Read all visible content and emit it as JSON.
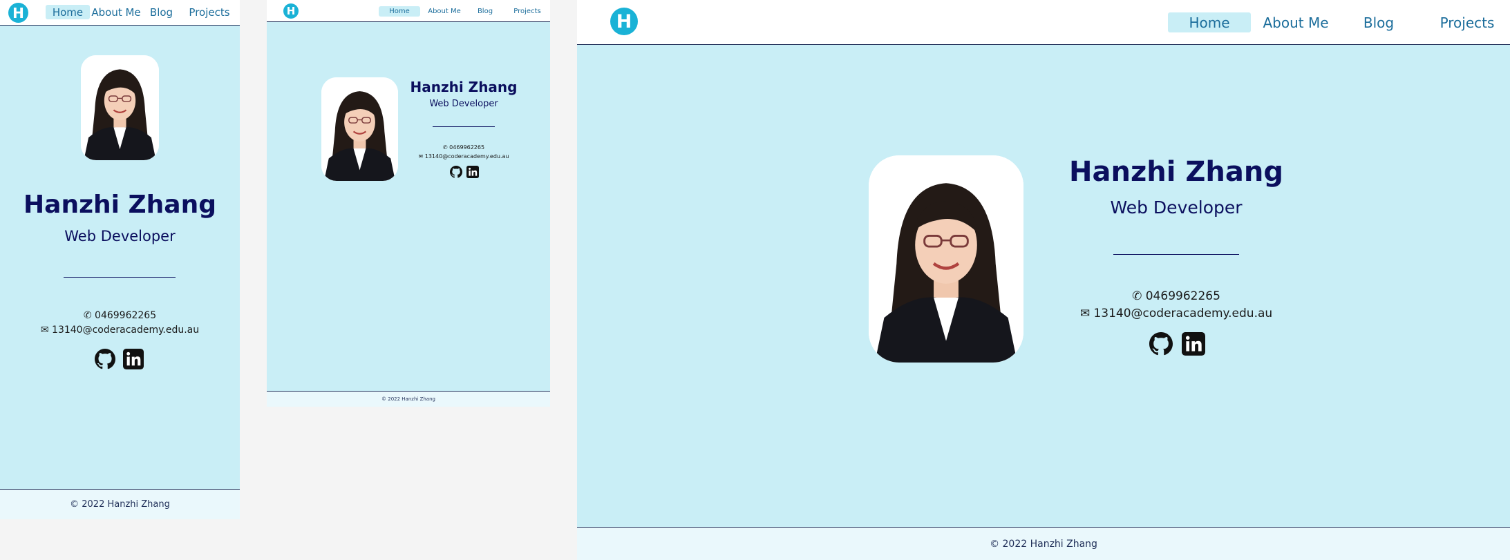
{
  "brand": {
    "logo_letter": "H"
  },
  "nav": {
    "items": [
      "Home",
      "About Me",
      "Blog",
      "Projects"
    ],
    "active_index": 0
  },
  "profile": {
    "name": "Hanzhi Zhang",
    "role": "Web Developer",
    "phone": "✆ 0469962265",
    "email": "✉ 13140@coderacademy.edu.au"
  },
  "social": {
    "icons": [
      "github-icon",
      "linkedin-icon"
    ]
  },
  "footer": {
    "text": "© 2022 Hanzhi Zhang"
  },
  "colors": {
    "page_bg": "#c9eef6",
    "nav_bg": "#ffffff",
    "nav_text": "#1b6d9b",
    "active_tab_bg": "#c9eef6",
    "logo": "#1ab2d6",
    "name_text": "#0b0f5e",
    "footer_bg": "#eaf8fc"
  }
}
